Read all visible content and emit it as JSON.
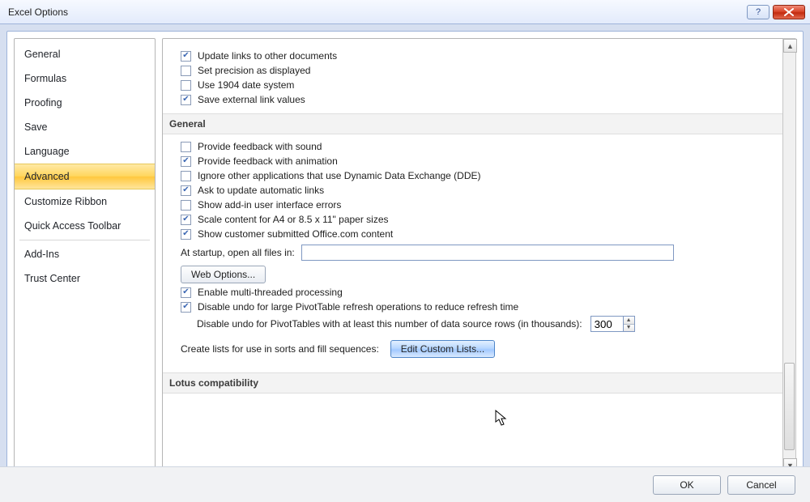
{
  "window": {
    "title": "Excel Options"
  },
  "nav": {
    "items": [
      "General",
      "Formulas",
      "Proofing",
      "Save",
      "Language",
      "Advanced",
      "Customize Ribbon",
      "Quick Access Toolbar",
      "Add-Ins",
      "Trust Center"
    ],
    "selected_index": 5
  },
  "top_checks": [
    {
      "checked": true,
      "label": "Update links to other documents"
    },
    {
      "checked": false,
      "label": "Set precision as displayed"
    },
    {
      "checked": false,
      "label": "Use 1904 date system"
    },
    {
      "checked": true,
      "label": "Save external link values"
    }
  ],
  "section_general": {
    "title": "General",
    "checks": [
      {
        "checked": false,
        "label": "Provide feedback with sound"
      },
      {
        "checked": true,
        "label": "Provide feedback with animation"
      },
      {
        "checked": false,
        "label": "Ignore other applications that use Dynamic Data Exchange (DDE)"
      },
      {
        "checked": true,
        "label": "Ask to update automatic links"
      },
      {
        "checked": false,
        "label": "Show add-in user interface errors"
      },
      {
        "checked": true,
        "label": "Scale content for A4 or 8.5 x 11\" paper sizes"
      },
      {
        "checked": true,
        "label": "Show customer submitted Office.com content"
      }
    ],
    "startup_label": "At startup, open all files in:",
    "startup_value": "",
    "web_options_label": "Web Options...",
    "multi_thread": {
      "checked": true,
      "label": "Enable multi-threaded processing"
    },
    "pivot_disable": {
      "checked": true,
      "label": "Disable undo for large PivotTable refresh operations to reduce refresh time"
    },
    "pivot_rows_label": "Disable undo for PivotTables with at least this number of data source rows (in thousands):",
    "pivot_rows_value": "300",
    "custom_lists_label": "Create lists for use in sorts and fill sequences:",
    "custom_lists_btn": "Edit Custom Lists..."
  },
  "section_lotus": {
    "title": "Lotus compatibility"
  },
  "footer": {
    "ok": "OK",
    "cancel": "Cancel"
  }
}
